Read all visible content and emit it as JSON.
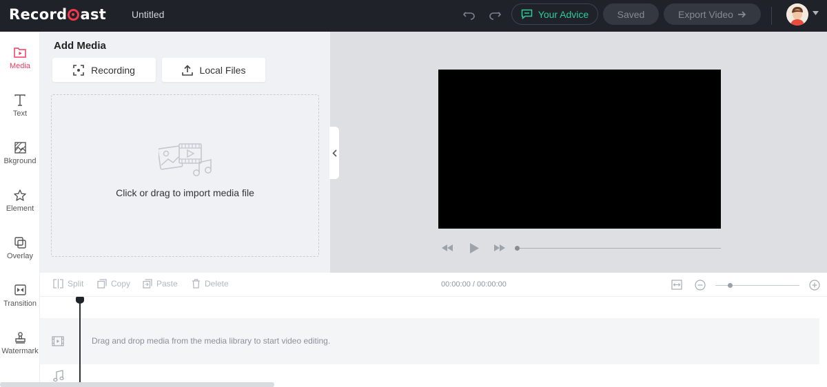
{
  "header": {
    "logo_text_left": "Record",
    "logo_text_right": "ast",
    "document_title": "Untitled",
    "advice_label": "Your Advice",
    "saved_label": "Saved",
    "export_label": "Export Video",
    "colors": {
      "bar": "#1f2329",
      "accent_green": "#2ecc9a",
      "brand_red": "#f03a4a"
    }
  },
  "rail": {
    "items": [
      {
        "label": "Media",
        "icon": "media-folder-icon",
        "active": true
      },
      {
        "label": "Text",
        "icon": "text-icon"
      },
      {
        "label": "Bkground",
        "icon": "background-icon"
      },
      {
        "label": "Element",
        "icon": "star-icon"
      },
      {
        "label": "Overlay",
        "icon": "overlay-icon"
      },
      {
        "label": "Transition",
        "icon": "transition-icon"
      },
      {
        "label": "Watermark",
        "icon": "stamp-icon"
      }
    ]
  },
  "media_panel": {
    "title": "Add Media",
    "recording_label": "Recording",
    "local_files_label": "Local Files",
    "dropzone_text": "Click or drag to import media file"
  },
  "timeline": {
    "split_label": "Split",
    "copy_label": "Copy",
    "paste_label": "Paste",
    "delete_label": "Delete",
    "time_display": "00:00:00 / 00:00:00",
    "empty_message": "Drag and drop media from the media library to start video editing."
  }
}
